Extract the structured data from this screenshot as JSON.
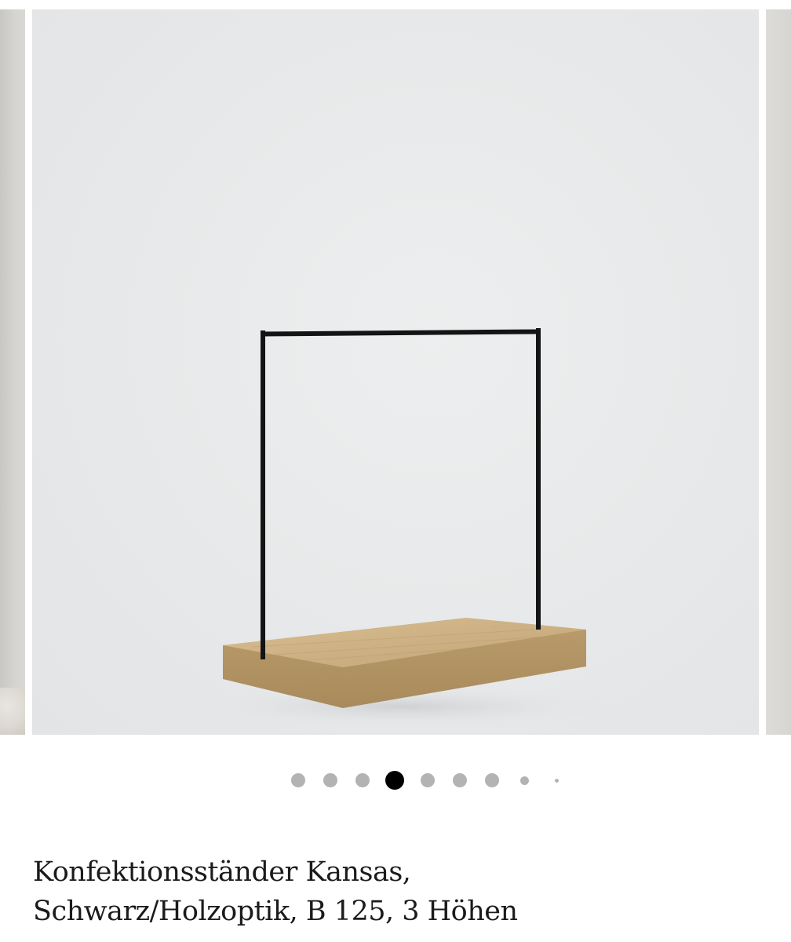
{
  "carousel": {
    "total_slides": 9,
    "active_slide_index": 3,
    "image_alt": "product-image-clothes-rack",
    "colors": {
      "background": "#e7e9ea",
      "rack_frame": "#141414",
      "wood_base": "#c3a678"
    }
  },
  "product": {
    "title_line1": "Konfektionsständer Kansas,",
    "title_line2": "Schwarz/Holzoptik, B 125, 3 Höhen"
  }
}
